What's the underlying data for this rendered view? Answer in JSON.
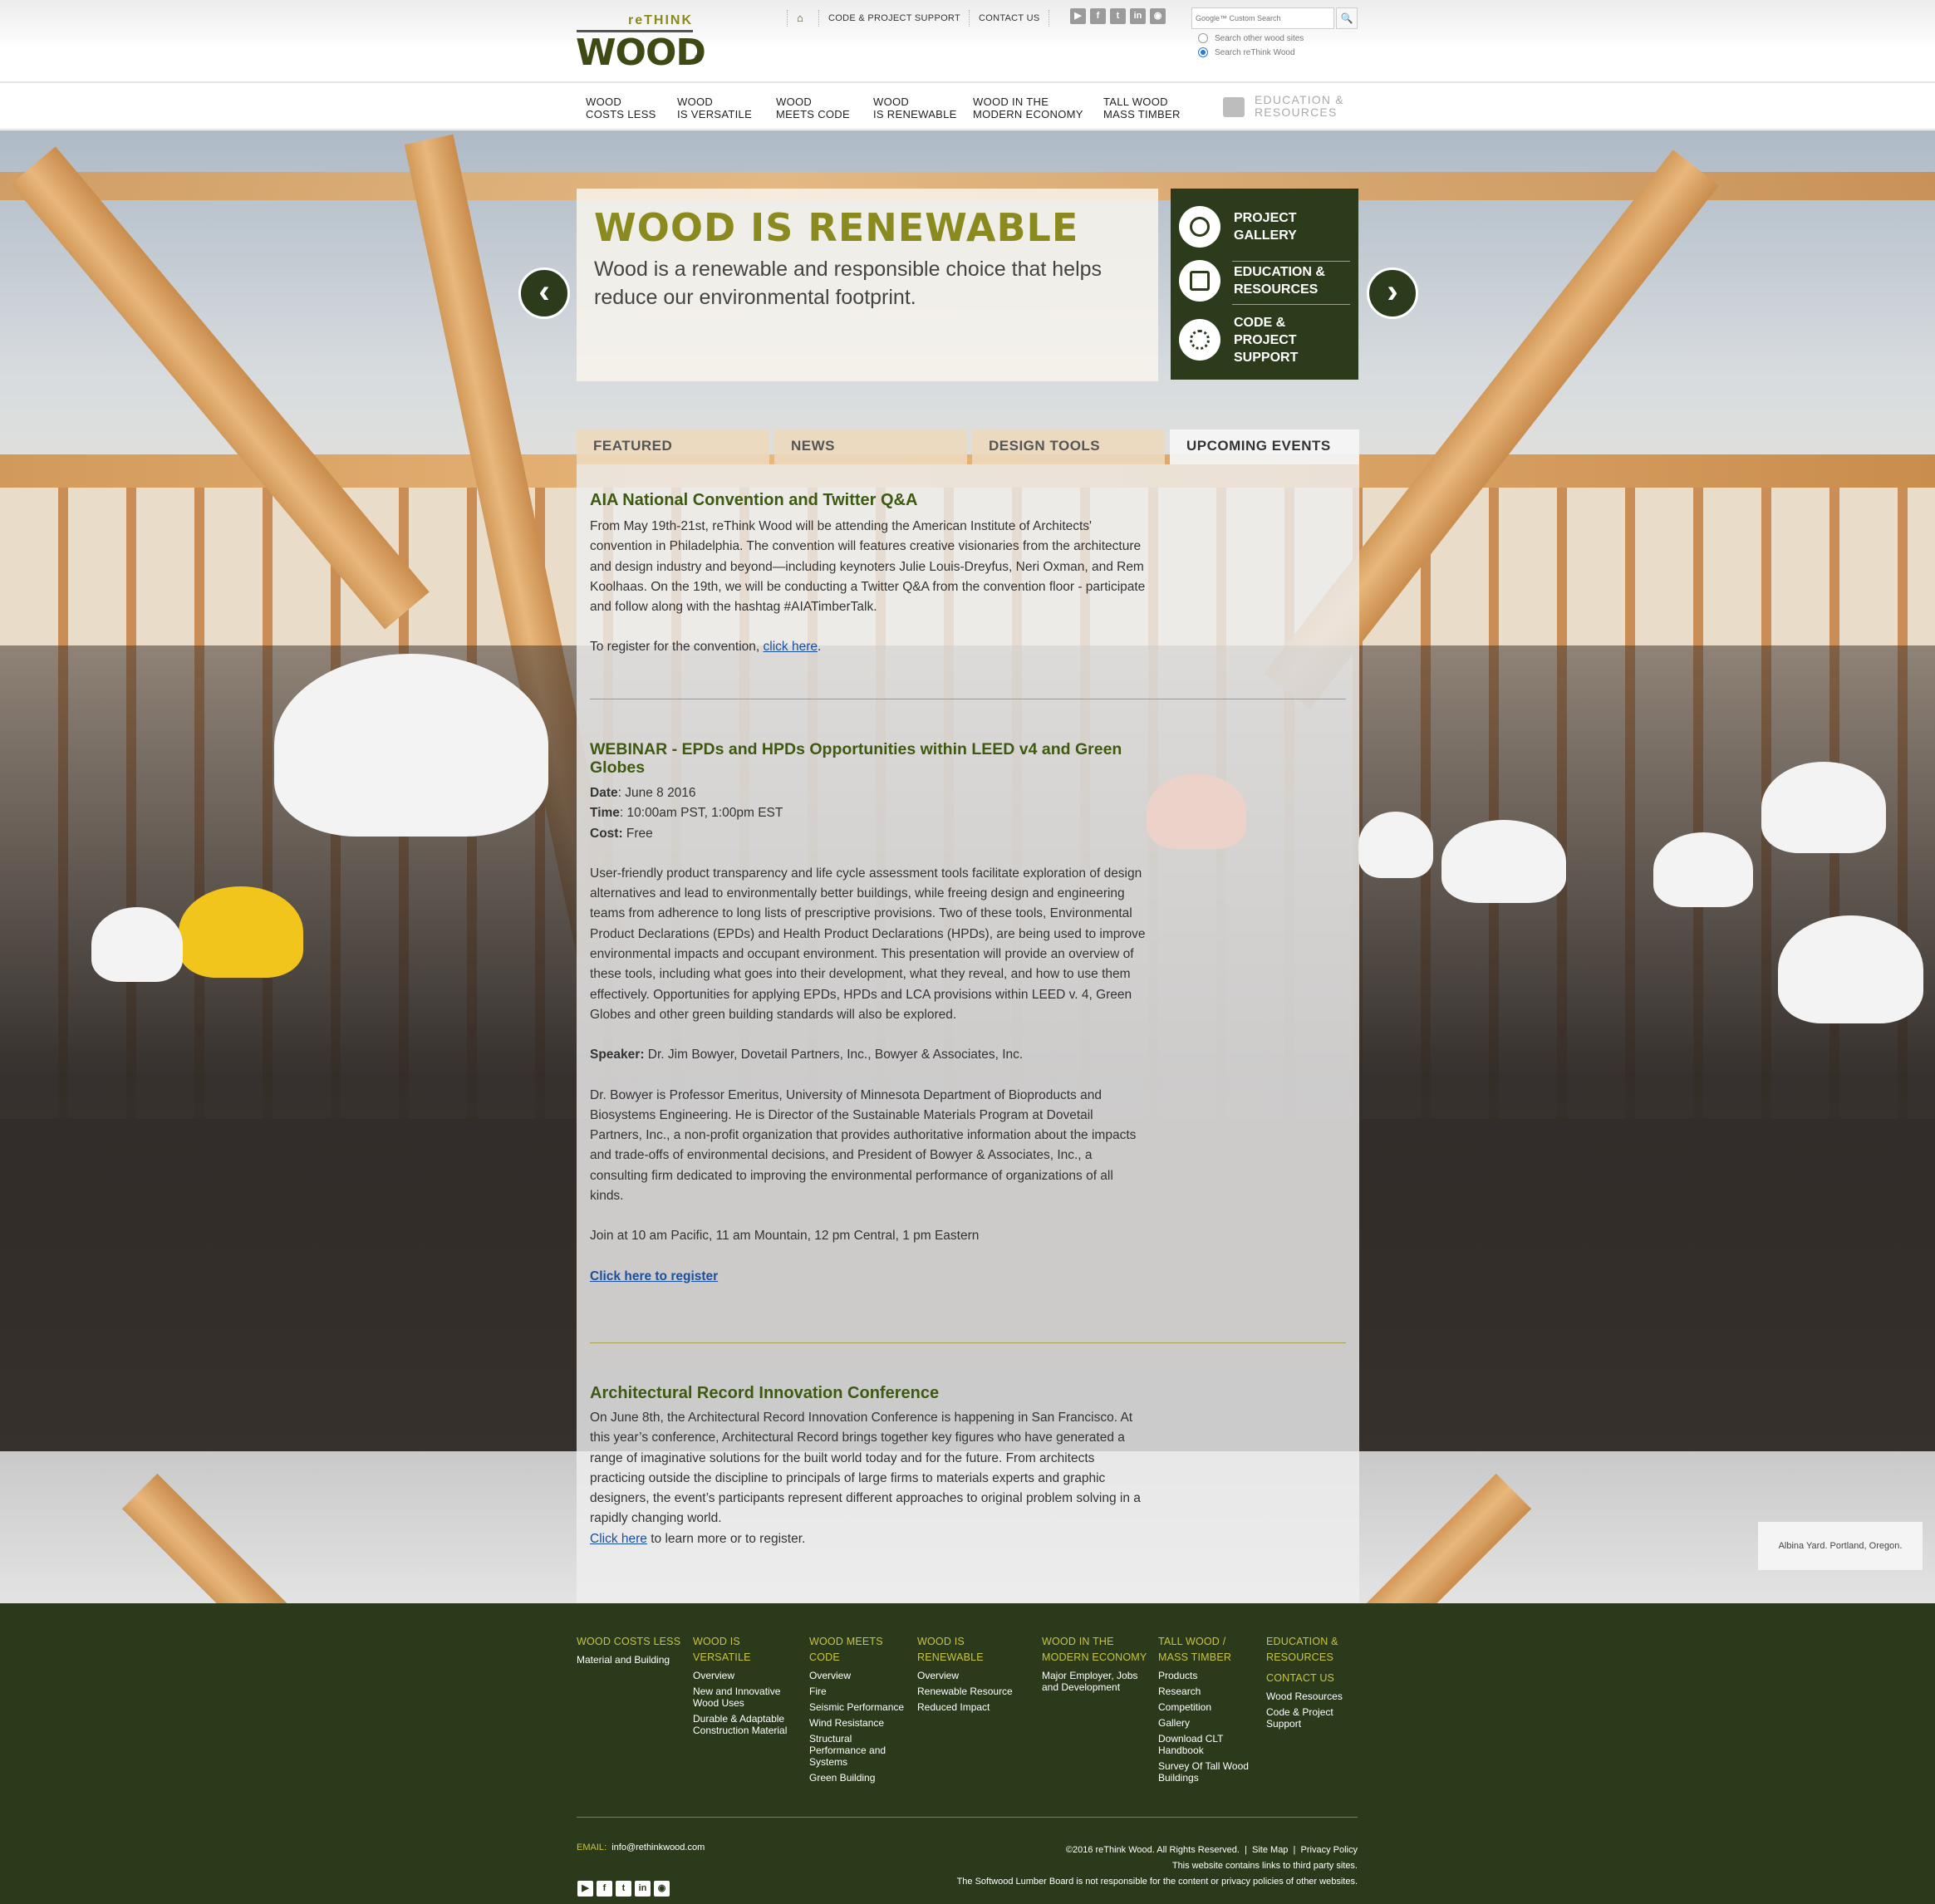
{
  "header": {
    "logo_top": "reTHINK",
    "logo_main": "WOOD",
    "logo_reg": "®",
    "topnav": [
      "CODE & PROJECT SUPPORT",
      "CONTACT US"
    ],
    "social": [
      "you",
      "f",
      "t",
      "in",
      "rss"
    ],
    "search_placeholder": "Google™ Custom Search",
    "search_options": [
      "Search other wood sites",
      "Search reThink Wood"
    ],
    "search_selected": "Search reThink Wood"
  },
  "mainnav": [
    {
      "line1": "WOOD",
      "line2": "COSTS LESS"
    },
    {
      "line1": "WOOD",
      "line2": "IS VERSATILE"
    },
    {
      "line1": "WOOD",
      "line2": "MEETS CODE"
    },
    {
      "line1": "WOOD",
      "line2": "IS RENEWABLE"
    },
    {
      "line1": "WOOD IN THE",
      "line2": "MODERN ECONOMY"
    },
    {
      "line1": "TALL WOOD",
      "line2": "MASS TIMBER"
    },
    {
      "line1": "EDUCATION &",
      "line2": "RESOURCES"
    }
  ],
  "banner": {
    "title": "WOOD IS RENEWABLE",
    "text": "Wood is a renewable and responsible choice that helps reduce our environmental footprint."
  },
  "quicklinks": [
    {
      "line1": "PROJECT",
      "line2": "GALLERY",
      "line3": "",
      "icon": "lightbulb-icon"
    },
    {
      "line1": "EDUCATION &",
      "line2": "RESOURCES",
      "line3": "",
      "icon": "monitor-icon"
    },
    {
      "line1": "CODE &",
      "line2": "PROJECT",
      "line3": "SUPPORT",
      "icon": "gears-icon"
    }
  ],
  "tabs": [
    "FEATURED",
    "NEWS",
    "DESIGN TOOLS",
    "UPCOMING EVENTS"
  ],
  "active_tab": "UPCOMING EVENTS",
  "posts": {
    "aia": {
      "title": "AIA National Convention and Twitter Q&A",
      "body": "From May 19th-21st, reThink Wood will be attending the American Institute of Architects' convention in Philadelphia. The convention will features creative visionaries from the architecture and design industry and beyond—including keynoters Julie Louis-Dreyfus, Neri Oxman, and Rem Koolhaas. On the 19th, we will be conducting a Twitter Q&A from the convention floor - participate and follow along with the hashtag #AIATimberTalk.",
      "register_prefix": "To register for the convention, ",
      "register_link": "click here",
      "register_suffix": "."
    },
    "webinar": {
      "title": "WEBINAR - EPDs and HPDs Opportunities within LEED v4 and Green Globes",
      "date_label": "Date",
      "date": ": June 8 2016",
      "time_label": "Time",
      "time": ": 10:00am PST, 1:00pm EST",
      "cost_label": "Cost:",
      "cost": " Free",
      "body": "User-friendly product transparency and life cycle assessment tools facilitate exploration of design alternatives and lead to environmentally better buildings, while freeing design and engineering teams from adherence to long lists of prescriptive provisions. Two of these tools, Environmental Product Declarations (EPDs) and Health Product Declarations (HPDs), are being used to improve environmental impacts and occupant environment. This presentation will provide an overview of these tools, including what goes into their development, what they reveal, and how to use them effectively. Opportunities for applying EPDs, HPDs and LCA provisions within LEED v. 4, Green Globes and other green building standards will also be explored.",
      "speaker_label": "Speaker:",
      "speaker": " Dr. Jim Bowyer, Dovetail Partners, Inc., Bowyer & Associates, Inc.",
      "bio": "Dr. Bowyer is Professor Emeritus, University of Minnesota Department of Bioproducts and Biosystems Engineering. He is Director of the Sustainable Materials Program at Dovetail Partners, Inc., a non-profit organization that provides authoritative information about the impacts and trade-offs of environmental decisions, and President of Bowyer & Associates, Inc., a consulting firm dedicated to improving the environmental performance of organizations of all kinds.",
      "join": "Join at 10 am Pacific, 11 am Mountain, 12 pm Central, 1 pm Eastern",
      "register_link": "Click here to register"
    },
    "arch": {
      "title": "Architectural Record Innovation Conference",
      "body": "On June 8th, the Architectural Record Innovation Conference is happening in San Francisco. At this year’s conference, Architectural Record brings together key figures who have generated a range of imaginative solutions for the built world today and for the future. From architects practicing outside the discipline to principals of large firms to materials experts and graphic designers, the event’s participants represent different approaches to original problem solving in a rapidly changing world.",
      "link": "Click here",
      "link_suffix": " to learn more or to register."
    }
  },
  "caption": "Albina Yard. Portland, Oregon.",
  "footer": {
    "columns": [
      {
        "head": "WOOD COSTS LESS",
        "items": [
          "Material and Building"
        ]
      },
      {
        "head": "WOOD IS VERSATILE",
        "items": [
          "Overview",
          "New and Innovative Wood Uses",
          "Durable & Adaptable Construction Material"
        ]
      },
      {
        "head": "WOOD MEETS CODE",
        "items": [
          "Overview",
          "Fire",
          "Seismic Performance",
          "Wind Resistance",
          "Structural Performance and Systems",
          "Green Building"
        ]
      },
      {
        "head": "WOOD IS RENEWABLE",
        "items": [
          "Overview",
          "Renewable Resource",
          "Reduced Impact"
        ]
      },
      {
        "head": "WOOD IN THE MODERN ECONOMY",
        "items": [
          "Major Employer, Jobs and Development"
        ]
      },
      {
        "head": "TALL WOOD / MASS TIMBER",
        "items": [
          "Products",
          "Research",
          "Competition",
          "Gallery",
          "Download CLT Handbook",
          "Survey Of Tall Wood Buildings"
        ]
      },
      {
        "head": "EDUCATION & RESOURCES",
        "items": []
      },
      {
        "head": "CONTACT US",
        "items": [
          "Wood Resources",
          "Code & Project Support"
        ]
      }
    ],
    "email_label": "EMAIL:",
    "email": "info@rethinkwood.com",
    "copyright": "©2016 reThink Wood. All Rights Reserved.",
    "sitemap": "Site Map",
    "privacy": "Privacy Policy",
    "note1": "This website contains links to third party sites.",
    "note2": "The Softwood Lumber Board is not responsible for the content or privacy policies of other websites.",
    "social": [
      "you",
      "f",
      "t",
      "in",
      "rss"
    ]
  },
  "colors": {
    "olive": "#8b8a1e",
    "darkgreen": "#2c3a1c",
    "headline_green": "#3d5a10"
  }
}
